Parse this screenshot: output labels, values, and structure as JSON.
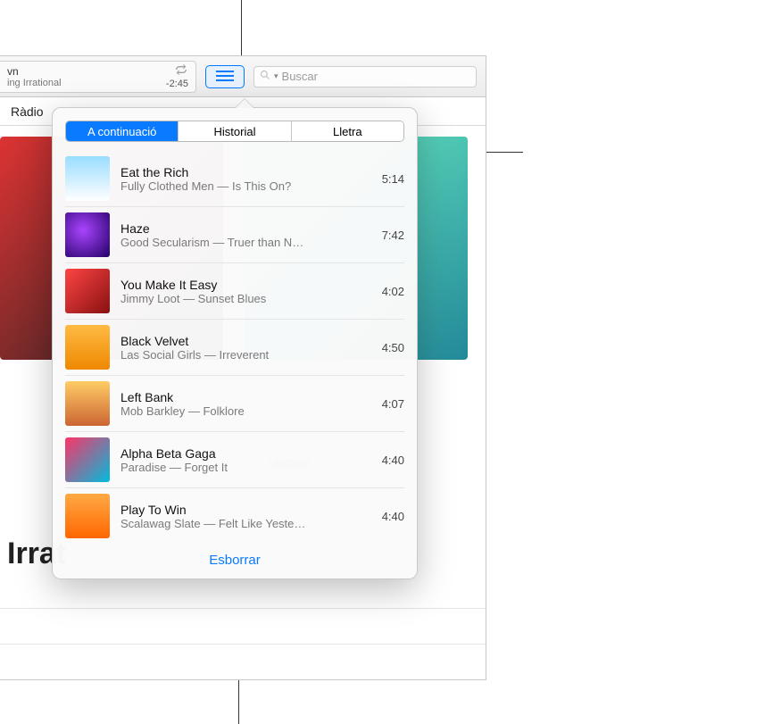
{
  "toolbar": {
    "now_playing_title": "vn",
    "now_playing_sub": "ing Irrational",
    "time_remaining": "-2:45",
    "search_placeholder": "Buscar"
  },
  "nav": {
    "tab_label": "Ràdio"
  },
  "background": {
    "caption_fragment": "nfiction",
    "big_title_fragment": "Irrat"
  },
  "popover": {
    "segments": {
      "up_next": "A continuació",
      "history": "Historial",
      "lyrics": "Lletra"
    },
    "clear_label": "Esborrar",
    "queue": [
      {
        "title": "Eat the Rich",
        "subtitle": "Fully Clothed Men — Is This On?",
        "duration": "5:14"
      },
      {
        "title": "Haze",
        "subtitle": "Good Secularism — Truer than N…",
        "duration": "7:42"
      },
      {
        "title": "You Make It Easy",
        "subtitle": "Jimmy Loot — Sunset Blues",
        "duration": "4:02"
      },
      {
        "title": "Black Velvet",
        "subtitle": "Las Social Girls — Irreverent",
        "duration": "4:50"
      },
      {
        "title": "Left Bank",
        "subtitle": "Mob Barkley — Folklore",
        "duration": "4:07"
      },
      {
        "title": "Alpha Beta Gaga",
        "subtitle": "Paradise — Forget It",
        "duration": "4:40"
      },
      {
        "title": "Play To Win",
        "subtitle": "Scalawag Slate — Felt Like Yeste…",
        "duration": "4:40"
      }
    ]
  }
}
